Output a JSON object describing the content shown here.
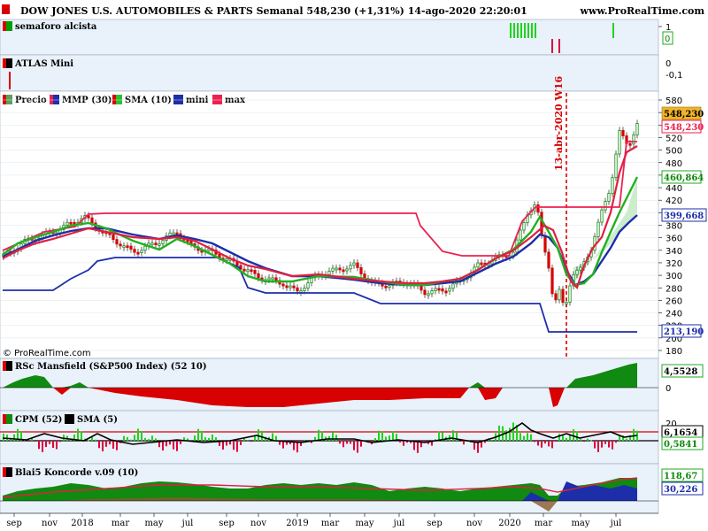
{
  "header": {
    "title": "DOW JONES U.S. AUTOMOBILES & PARTS Semanal 548,230 (+1,31%) 14-ago-2020 22:20:01",
    "site": "www.ProRealTime.com"
  },
  "panels": {
    "semaforo": {
      "label": "semaforo alcista",
      "axis": [
        "1",
        "0"
      ],
      "value": "0"
    },
    "atlas": {
      "label": "ATLAS Mini",
      "axis": [
        "0",
        "-0,1"
      ]
    },
    "price": {
      "legend": [
        "Precio",
        "MMP (30)",
        "SMA (10)",
        "mini",
        "max"
      ],
      "annotation": "13-abr-2020 W16",
      "axis_ticks": [
        "580",
        "560",
        "540",
        "520",
        "500",
        "480",
        "460",
        "440",
        "420",
        "400",
        "380",
        "360",
        "340",
        "320",
        "300",
        "280",
        "260",
        "240",
        "220",
        "200",
        "180"
      ],
      "tags": {
        "close": "548,230",
        "max_tag": "548,230",
        "sma": "460,864",
        "mmp": "399,668",
        "mini": "213,190"
      },
      "watermark": "© ProRealTime.com"
    },
    "rsc": {
      "label": "RSc Mansfield (S&P500 Index) (52 10)",
      "value": "4,5528",
      "zero": "0"
    },
    "cpm": {
      "label": "CPM (52)",
      "label2": "SMA (5)",
      "axis": [
        "20",
        "0"
      ],
      "value1": "6,1654",
      "value2": "0,5841"
    },
    "koncorde": {
      "label": "Blai5 Koncorde v.09 (10)",
      "value1": "118,67",
      "value2": "30,226"
    }
  },
  "x_axis": [
    "sep",
    "nov",
    "2018",
    "mar",
    "may",
    "jul",
    "sep",
    "nov",
    "2019",
    "mar",
    "may",
    "jul",
    "sep",
    "nov",
    "2020",
    "mar",
    "may",
    "jul"
  ],
  "colors": {
    "panel_bg": "#e9f1fa",
    "up": "#00a000",
    "down": "#d80000",
    "mmp": "#ff1f4f",
    "sma": "#2dbf2d",
    "mini": "#1c2fa8",
    "max": "#ee2050",
    "tag_close": "#f0b429"
  },
  "chart_data": {
    "type": "line",
    "title": "DOW JONES U.S. AUTOMOBILES & PARTS Semanal",
    "x": [
      "sep",
      "nov",
      "2018",
      "mar",
      "may",
      "jul",
      "sep",
      "nov",
      "2019",
      "mar",
      "may",
      "jul",
      "sep",
      "nov",
      "2020",
      "mar",
      "may",
      "jul"
    ],
    "ylim": [
      180,
      580
    ],
    "series": [
      {
        "name": "Precio",
        "values": [
          330,
          365,
          385,
          340,
          370,
          335,
          295,
          300,
          290,
          305,
          300,
          295,
          290,
          340,
          385,
          240,
          360,
          548.23
        ]
      },
      {
        "name": "MMP (30)",
        "values": [
          330,
          355,
          370,
          360,
          355,
          345,
          320,
          305,
          300,
          300,
          300,
          300,
          295,
          320,
          350,
          340,
          300,
          399.668
        ]
      },
      {
        "name": "SMA (10)",
        "values": [
          330,
          358,
          375,
          345,
          360,
          340,
          305,
          300,
          295,
          302,
          300,
          296,
          292,
          330,
          370,
          300,
          320,
          460.864
        ]
      },
      {
        "name": "mini",
        "values": [
          275,
          280,
          315,
          335,
          330,
          330,
          280,
          275,
          275,
          275,
          255,
          255,
          255,
          255,
          255,
          213.19,
          213.19,
          213.19
        ]
      },
      {
        "name": "max",
        "values": [
          380,
          385,
          400,
          380,
          385,
          385,
          385,
          385,
          385,
          385,
          385,
          385,
          335,
          335,
          410,
          410,
          410,
          548.23
        ]
      }
    ]
  }
}
